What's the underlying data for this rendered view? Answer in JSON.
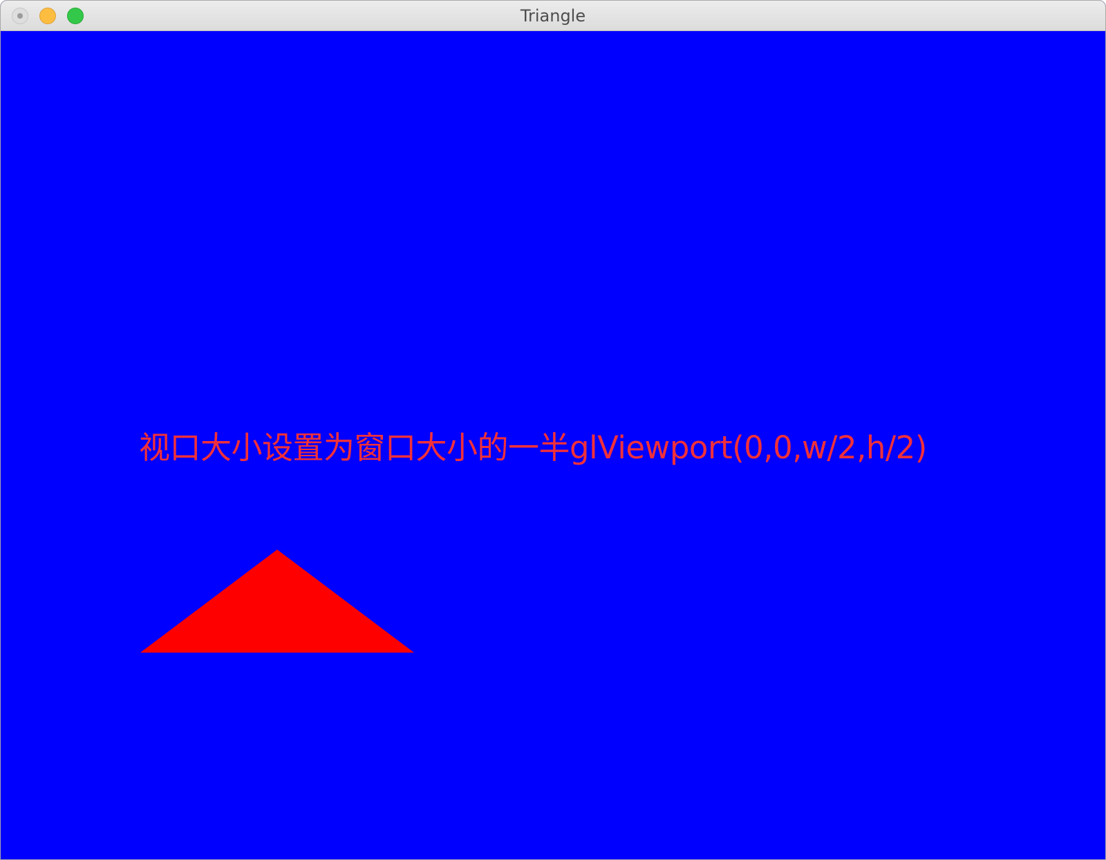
{
  "window": {
    "title": "Triangle"
  },
  "colors": {
    "background": "#0000fe",
    "triangle": "#ff0000",
    "caption": "#f0303a"
  },
  "content": {
    "caption": "视口大小设置为窗口大小的一半glViewport(0,0,w/2,h/2)"
  },
  "icons": {
    "close": "close-button-icon",
    "minimize": "minimize-button-icon",
    "zoom": "zoom-button-icon"
  }
}
